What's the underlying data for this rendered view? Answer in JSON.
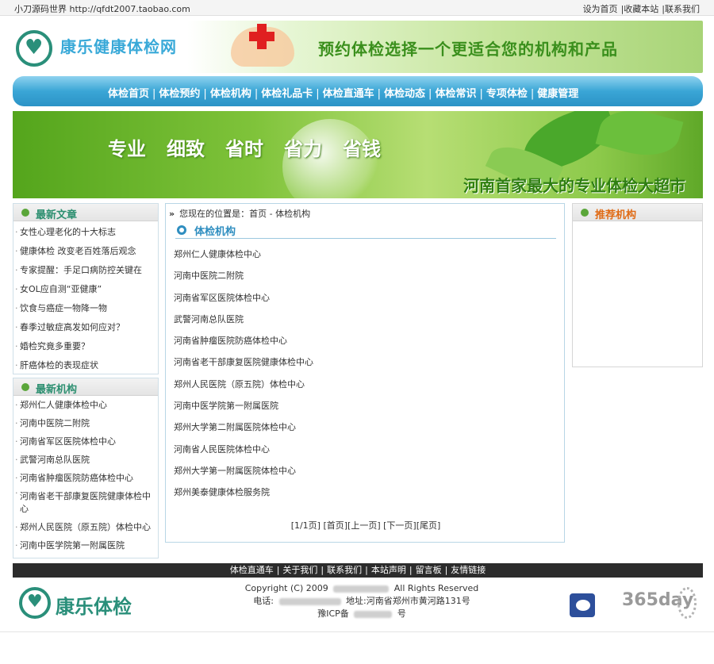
{
  "topbar": {
    "site_info": "小刀源码世界 http://qfdt2007.taobao.com",
    "links": [
      "设为首页",
      "|收藏本站",
      "|联系我们"
    ]
  },
  "header": {
    "logo_text": "康乐健康体检网",
    "slogan": "预约体检选择一个更适合您的机构和产品"
  },
  "nav": {
    "items": [
      "体检首页",
      "体检预约",
      "体检机构",
      "体检礼品卡",
      "体检直通车",
      "体检动态",
      "体检常识",
      "专项体检",
      "健康管理"
    ]
  },
  "banner": {
    "words": [
      "专业",
      "细致",
      "省时",
      "省力",
      "省钱"
    ],
    "tagline": "河南首家最大的专业体检大超市"
  },
  "latest_articles": {
    "title": "最新文章",
    "items": [
      "女性心理老化的十大标志",
      "健康体检 改变老百姓落后观念",
      "专家提醒：手足口病防控关键在",
      "女OL应自测“亚健康”",
      "饮食与癌症一物降一物",
      "春季过敏症高发如何应对？",
      "婚检究竟多重要？",
      "肝癌体检的表现症状"
    ]
  },
  "latest_orgs": {
    "title": "最新机构",
    "items": [
      "郑州仁人健康体检中心",
      "河南中医院二附院",
      "河南省军区医院体检中心",
      "武警河南总队医院",
      "河南省肿瘤医院防癌体检中心",
      "河南省老干部康复医院健康体检中心",
      "郑州人民医院（原五院）体检中心",
      "河南中医学院第一附属医院"
    ]
  },
  "main": {
    "breadcrumb": "您现在的位置是：首页 - 体检机构",
    "section_title": "体检机构",
    "orgs": [
      "郑州仁人健康体检中心",
      "河南中医院二附院",
      "河南省军区医院体检中心",
      "武警河南总队医院",
      "河南省肿瘤医院防癌体检中心",
      "河南省老干部康复医院健康体检中心",
      "郑州人民医院（原五院）体检中心",
      "河南中医学院第一附属医院",
      "郑州大学第二附属医院体检中心",
      "河南省人民医院体检中心",
      "郑州大学第一附属医院体检中心",
      "郑州美泰健康体检服务院"
    ],
    "pager": "[1/1页] [首页][上一页] [下一页][尾页]"
  },
  "recommend": {
    "title": "推荐机构"
  },
  "footer_nav": {
    "items": [
      "体检直通车",
      "关于我们",
      "联系我们",
      "本站声明",
      "留言板",
      "友情链接"
    ]
  },
  "footer": {
    "logo_text": "康乐体检",
    "copyright_prefix": "Copyright (C) 2009",
    "copyright_suffix": "All Rights Reserved",
    "phone_label": "电话:",
    "address": "地址:河南省郑州市黄河路131号",
    "icp_label": "豫ICP备",
    "icp_suffix": "号",
    "badge_text": "365day"
  }
}
